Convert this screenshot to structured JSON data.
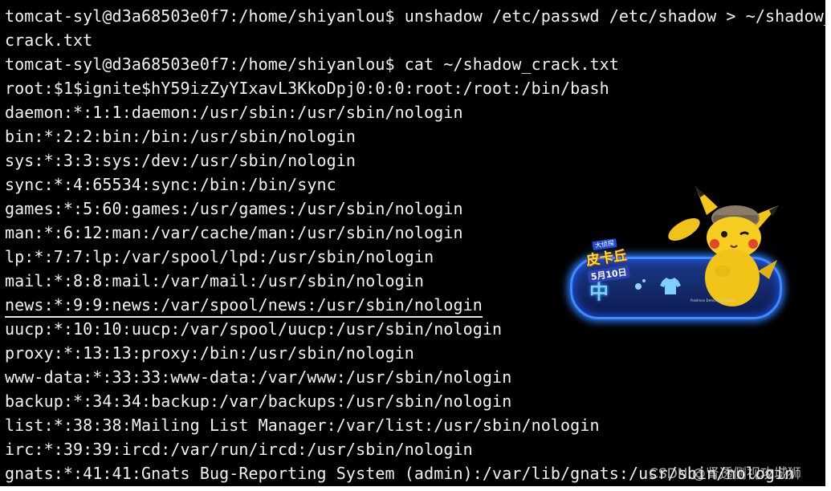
{
  "terminal": {
    "lines": [
      "tomcat-syl@d3a68503e0f7:/home/shiyanlou$ unshadow /etc/passwd /etc/shadow > ~/shadow_",
      "crack.txt",
      "tomcat-syl@d3a68503e0f7:/home/shiyanlou$ cat ~/shadow_crack.txt",
      "root:$1$ignite$hY59izZyYIxavL3KkoDpj0:0:0:root:/root:/bin/bash",
      "daemon:*:1:1:daemon:/usr/sbin:/usr/sbin/nologin",
      "bin:*:2:2:bin:/bin:/usr/sbin/nologin",
      "sys:*:3:3:sys:/dev:/usr/sbin/nologin",
      "sync:*:4:65534:sync:/bin:/bin/sync",
      "games:*:5:60:games:/usr/games:/usr/sbin/nologin",
      "man:*:6:12:man:/var/cache/man:/usr/sbin/nologin",
      "lp:*:7:7:lp:/var/spool/lpd:/usr/sbin/nologin",
      "mail:*:8:8:mail:/var/mail:/usr/sbin/nologin",
      "news:*:9:9:news:/var/spool/news:/usr/sbin/nologin",
      "uucp:*:10:10:uucp:/var/spool/uucp:/usr/sbin/nologin",
      "proxy:*:13:13:proxy:/bin:/usr/sbin/nologin",
      "www-data:*:33:33:www-data:/var/www:/usr/sbin/nologin",
      "backup:*:34:34:backup:/var/backups:/usr/sbin/nologin",
      "list:*:38:38:Mailing List Manager:/var/list:/usr/sbin/nologin",
      "irc:*:39:39:ircd:/var/run/ircd:/usr/sbin/nologin",
      "gnats:*:41:41:Gnats Bug-Reporting System (admin):/var/lib/gnats:/usr/sbin/nologin"
    ]
  },
  "overlay": {
    "badge_small": "大侦探",
    "badge_main": "皮卡丘",
    "badge_date": "5月10日",
    "char": "中",
    "fine_print": "Pokémon Detective Pikachu",
    "icons": [
      "pikachu-mascot-icon",
      "moon-dot-icon",
      "tshirt-icon"
    ]
  },
  "watermark": "CSDN @肾透侧视攻城狮",
  "colors": {
    "terminal_bg": "#000000",
    "terminal_fg": "#f2f2f2",
    "widget_border": "#3f8cff",
    "badge_yellow": "#ffe21a"
  }
}
